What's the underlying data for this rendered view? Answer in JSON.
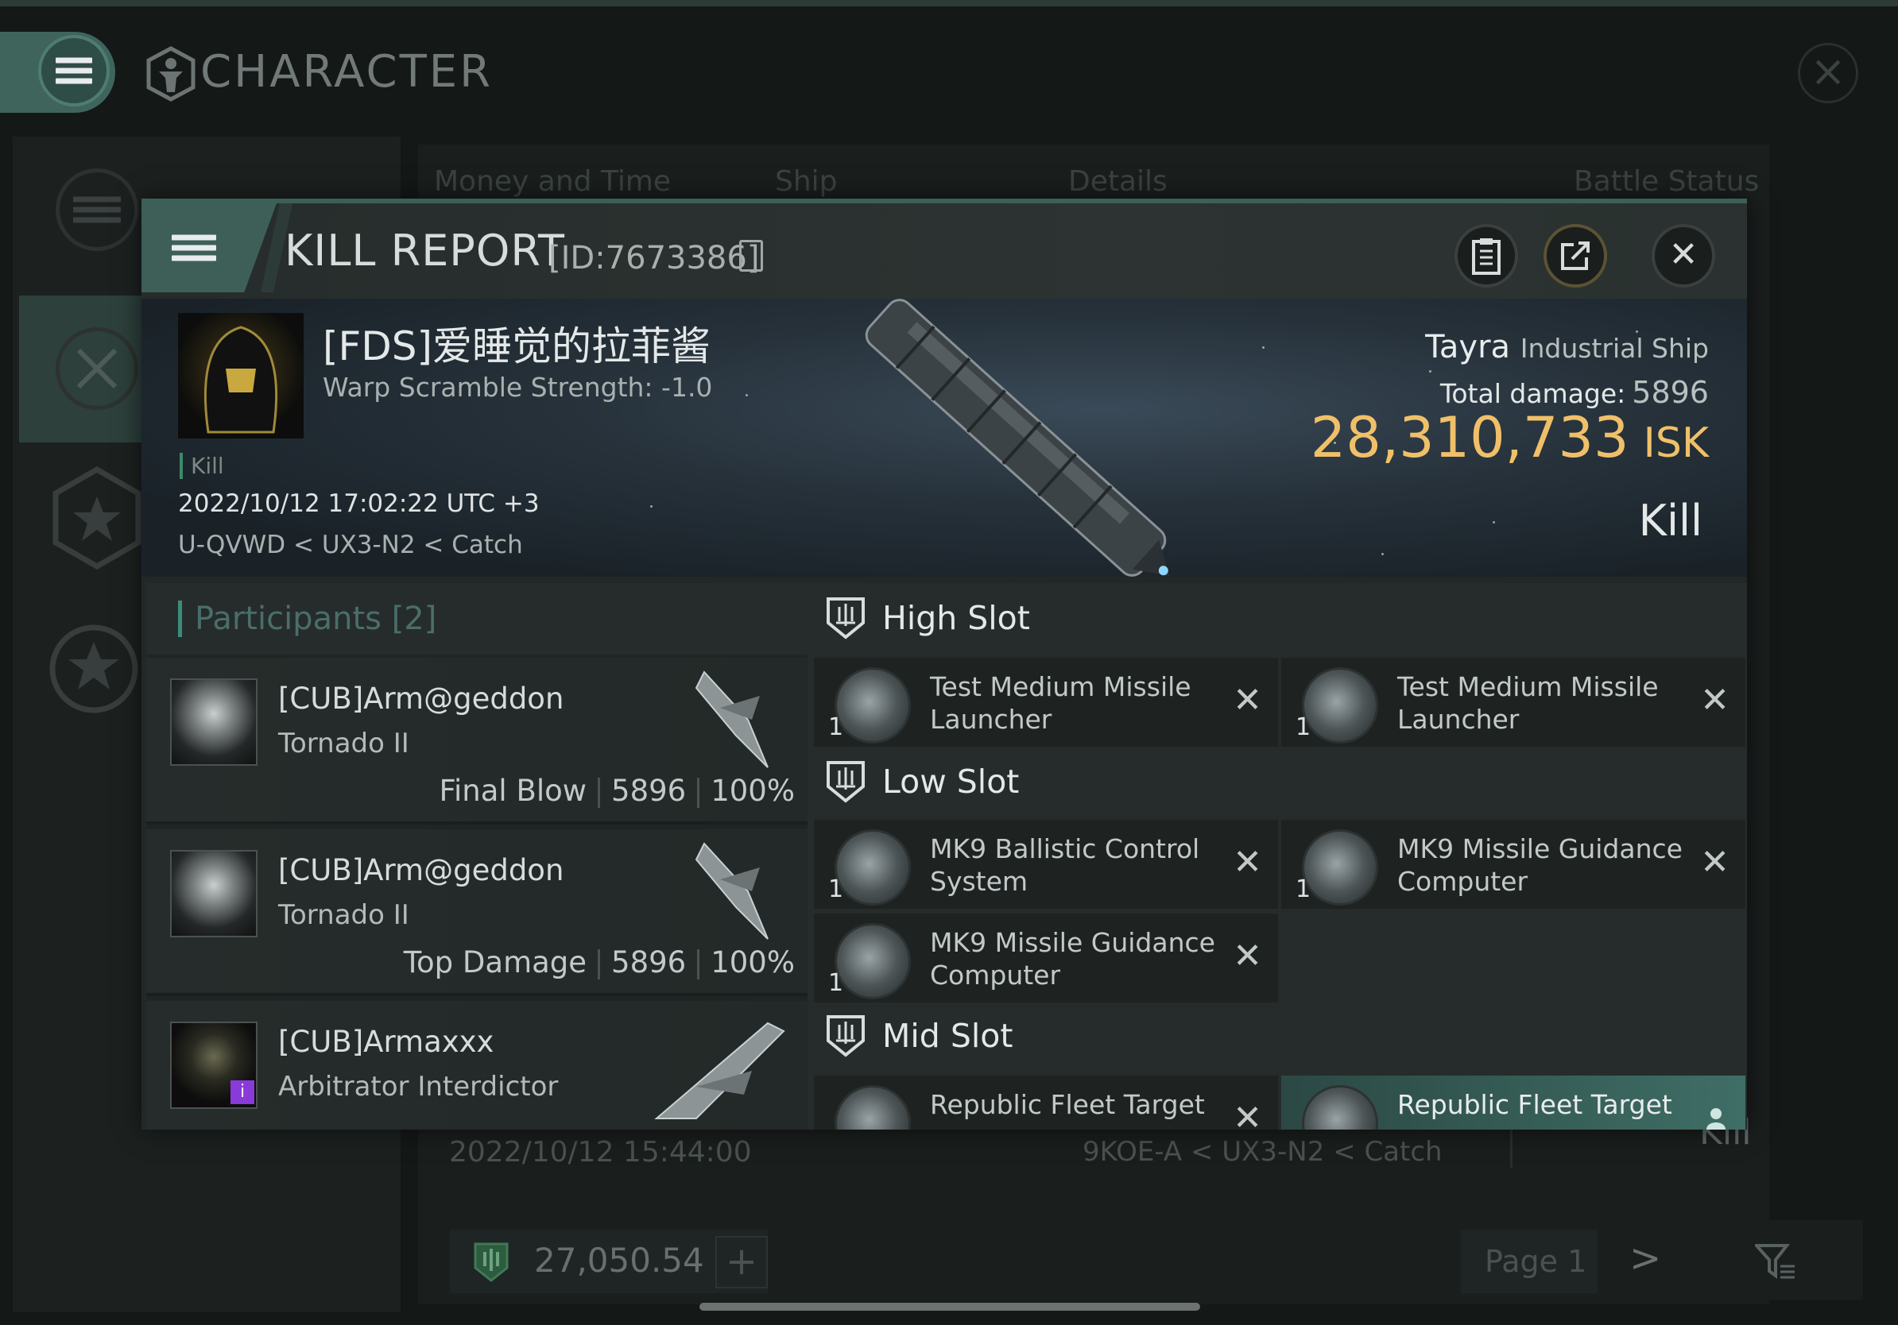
{
  "app": {
    "title": "CHARACTER"
  },
  "background": {
    "columns": [
      "Money and Time",
      "Ship",
      "Details",
      "Battle Status"
    ],
    "row_date": "2022/10/12 15:44:00",
    "row_location": "9KOE-A < UX3-N2 < Catch",
    "row_result": "Kill",
    "wallet_value": "27,050.54",
    "wallet_add": "+",
    "page_label": "Page 1",
    "next_symbol": ">"
  },
  "dialog": {
    "title": "KILL REPORT",
    "id_text": "[ID:7673386]",
    "close_symbol": "✕"
  },
  "victim": {
    "name": "[FDS]爱睡觉的拉菲酱",
    "warp_scramble": "Warp Scramble Strength: -1.0",
    "tag": "Kill",
    "datetime": "2022/10/12 17:02:22 UTC +3",
    "location": "U-QVWD < UX3-N2 < Catch",
    "ship_name": "Tayra",
    "ship_class": "Industrial Ship",
    "total_damage_label": "Total damage:",
    "total_damage_value": "5896",
    "isk_value": "28,310,733",
    "isk_unit": "ISK",
    "result": "Kill"
  },
  "participants": {
    "label": "Participants",
    "count": "[2]",
    "items": [
      {
        "name": "[CUB]Arm@geddon",
        "ship": "Tornado II",
        "role": "Final Blow",
        "damage": "5896",
        "percent": "100%"
      },
      {
        "name": "[CUB]Arm@geddon",
        "ship": "Tornado II",
        "role": "Top Damage",
        "damage": "5896",
        "percent": "100%"
      },
      {
        "name": "[CUB]Armaxxx",
        "ship": "Arbitrator Interdictor",
        "badge": "i"
      }
    ]
  },
  "fitting": {
    "high_slot": {
      "title": "High Slot",
      "modules": [
        {
          "qty": "1",
          "name": "Test Medium Missile Launcher"
        },
        {
          "qty": "1",
          "name": "Test Medium Missile Launcher"
        }
      ]
    },
    "low_slot": {
      "title": "Low Slot",
      "modules": [
        {
          "qty": "1",
          "name": "MK9 Ballistic Control System"
        },
        {
          "qty": "1",
          "name": "MK9 Missile Guidance Computer"
        },
        {
          "qty": "1",
          "name": "MK9 Missile Guidance Computer"
        }
      ]
    },
    "mid_slot": {
      "title": "Mid Slot",
      "modules": [
        {
          "name": "Republic Fleet Target"
        },
        {
          "name": "Republic Fleet Target"
        }
      ]
    },
    "remove_symbol": "✕"
  },
  "colors": {
    "accent": "#3d5f58",
    "isk": "#f0c069",
    "selected_row": "#3f6e66",
    "badge": "#8a3ad8"
  },
  "icons": [
    "menu-icon",
    "character-icon",
    "close-icon",
    "clipboard-icon",
    "share-icon",
    "slot-shield-icon",
    "filter-icon",
    "wallet-icon"
  ]
}
